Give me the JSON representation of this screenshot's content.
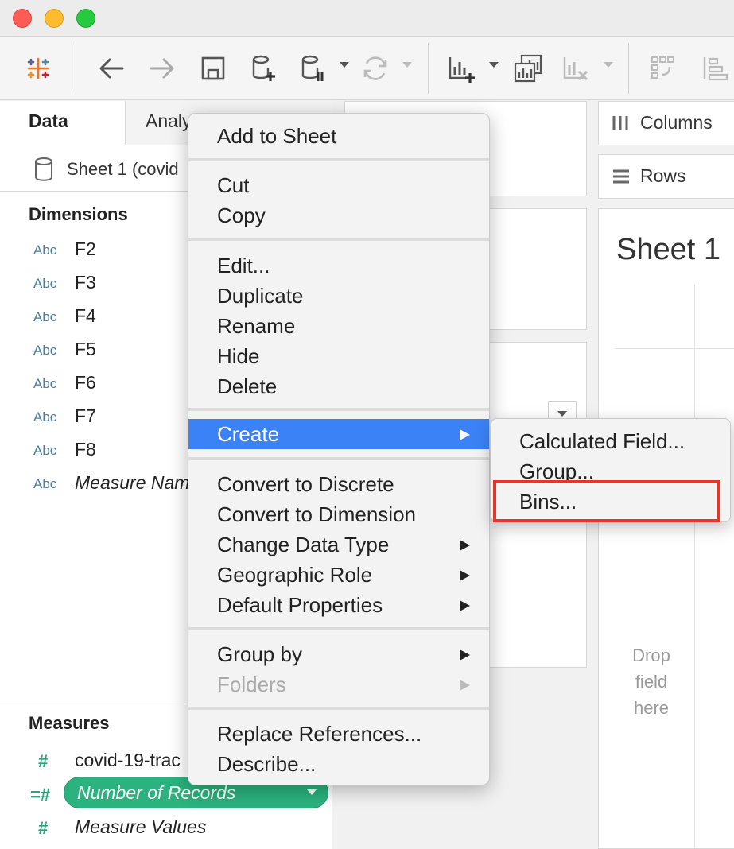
{
  "left_panel": {
    "tabs": {
      "data": "Data",
      "analytics": "Analy"
    },
    "datasource": "Sheet 1 (covid",
    "dimensions_title": "Dimensions",
    "dimension_type": "Abc",
    "dimensions": [
      "F2",
      "F3",
      "F4",
      "F5",
      "F6",
      "F7",
      "F8"
    ],
    "measure_names": "Measure Nam",
    "measures_title": "Measures",
    "measures": [
      "covid-19-trac",
      "Number of Records",
      "Measure Values"
    ]
  },
  "shelves": {
    "columns": "Columns",
    "rows": "Rows"
  },
  "sheet": {
    "title": "Sheet 1",
    "drop_lines": [
      "Drop",
      "field",
      "here"
    ]
  },
  "context_menu": {
    "add_to_sheet": "Add to Sheet",
    "cut": "Cut",
    "copy": "Copy",
    "edit": "Edit...",
    "duplicate": "Duplicate",
    "rename": "Rename",
    "hide": "Hide",
    "delete": "Delete",
    "create": "Create",
    "convert_discrete": "Convert to Discrete",
    "convert_dimension": "Convert to Dimension",
    "change_data_type": "Change Data Type",
    "geographic_role": "Geographic Role",
    "default_properties": "Default Properties",
    "group_by": "Group by",
    "folders": "Folders",
    "replace_references": "Replace References...",
    "describe": "Describe..."
  },
  "submenu": {
    "calculated_field": "Calculated Field...",
    "group": "Group...",
    "bins": "Bins..."
  },
  "colors": {
    "highlight": "#3b82f6",
    "annotation": "#e8352c",
    "pill": "#2bb27e"
  }
}
